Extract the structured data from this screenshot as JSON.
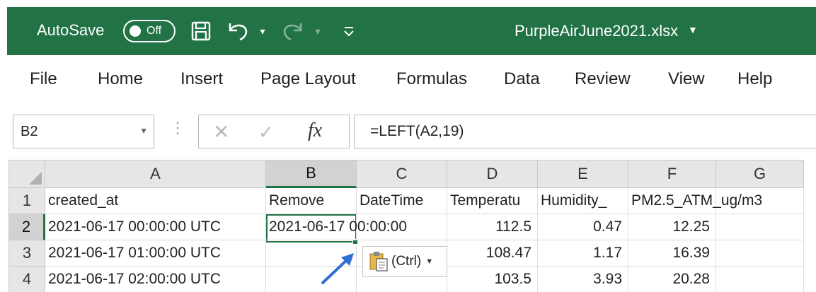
{
  "titlebar": {
    "autosave_label": "AutoSave",
    "autosave_state": "Off",
    "document_title": "PurpleAirJune2021.xlsx",
    "icons": [
      "save-icon",
      "undo-icon",
      "redo-icon",
      "customize-qat-icon"
    ]
  },
  "menu": {
    "items": [
      "File",
      "Home",
      "Insert",
      "Page Layout",
      "Formulas",
      "Data",
      "Review",
      "View",
      "Help"
    ]
  },
  "formula_bar": {
    "name_box": "B2",
    "formula": "=LEFT(A2,19)",
    "fx_label": "fx"
  },
  "sheet": {
    "columns": [
      "A",
      "B",
      "C",
      "D",
      "E",
      "F",
      "G"
    ],
    "selected_column": "B",
    "selected_row": "2",
    "rows": [
      {
        "num": "1",
        "A": "created_at",
        "B": "Remove",
        "C": "DateTime",
        "D": "Temperatu",
        "E": "Humidity_",
        "F": "PM2.5_ATM_ug/m3",
        "G": ""
      },
      {
        "num": "2",
        "A": "2021-06-17 00:00:00 UTC",
        "B": "2021-06-17 00:00:00",
        "C": "",
        "D": "112.5",
        "E": "0.47",
        "F": "12.25",
        "G": ""
      },
      {
        "num": "3",
        "A": "2021-06-17 01:00:00 UTC",
        "B": "",
        "C": "",
        "D": "108.47",
        "E": "1.17",
        "F": "16.39",
        "G": ""
      },
      {
        "num": "4",
        "A": "2021-06-17 02:00:00 UTC",
        "B": "",
        "C": "",
        "D": "103.5",
        "E": "3.93",
        "F": "20.28",
        "G": ""
      }
    ]
  },
  "paste_options": {
    "label": "(Ctrl)"
  },
  "colors": {
    "excel_green": "#217346",
    "arrow_blue": "#2f6fd6"
  }
}
